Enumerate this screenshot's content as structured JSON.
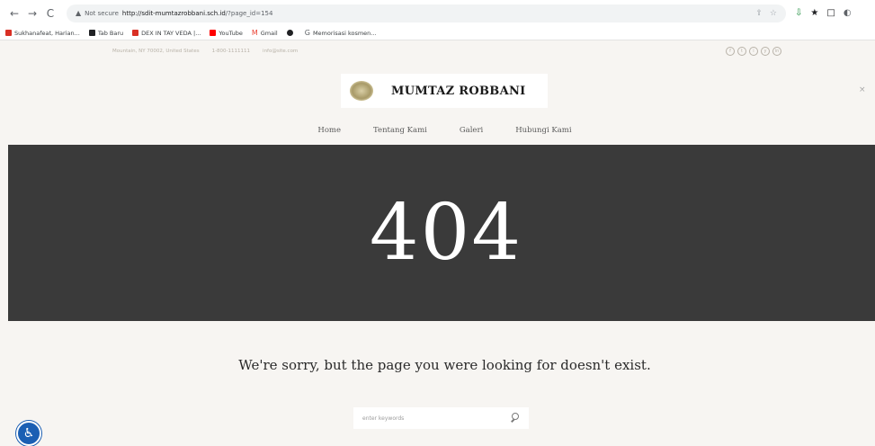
{
  "browser": {
    "back": "←",
    "forward": "→",
    "reload": "C",
    "security_label": "Not secure",
    "url_host": "http://sdit-mumtazrobbani.sch.id",
    "url_path": "/?page_id=154",
    "ext_icons": [
      "⇩",
      "★",
      "□",
      "◐"
    ]
  },
  "bookmarks": [
    {
      "label": "Sukhanafeat, Harian...",
      "color": "#d93025"
    },
    {
      "label": "Tab Baru",
      "color": "#202124"
    },
    {
      "label": "DEX IN TAY VEDA |...",
      "color": "#d93025"
    },
    {
      "label": "YouTube",
      "color": "#ff0000"
    },
    {
      "label": "Gmail",
      "color": "#1a73e8"
    },
    {
      "label": "",
      "color": "#202124"
    },
    {
      "label": "Memorisasi kosmen...",
      "color": "#5f6368"
    }
  ],
  "site": {
    "topinfo": [
      "Mountain, NY 70002, United States",
      "1-800-1111111",
      "info@site.com"
    ],
    "brand_name": "MUMTAZ ROBBANI",
    "close": "×",
    "nav": [
      "Home",
      "Tentang Kami",
      "Galeri",
      "Hubungi Kami"
    ],
    "error_code": "404",
    "message": "We're sorry, but the page you were looking for doesn't exist.",
    "search_placeholder": "enter keywords"
  },
  "colors": {
    "hero_bg": "#3a3a3a",
    "page_bg": "#f7f5f2",
    "accessibility": "#1b5fb3"
  }
}
